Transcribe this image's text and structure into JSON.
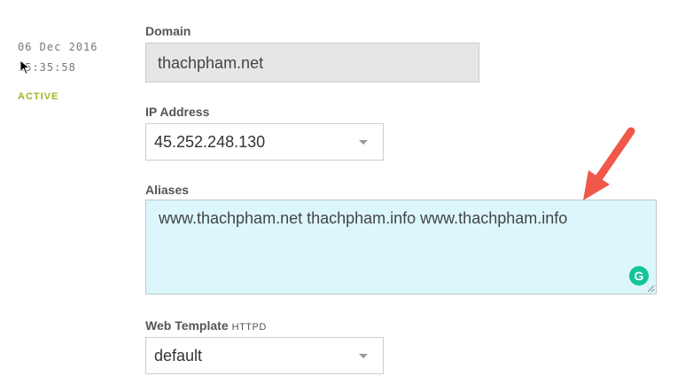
{
  "meta": {
    "date": "06 Dec 2016",
    "time": "15:35:58",
    "status": "ACTIVE"
  },
  "form": {
    "domain": {
      "label": "Domain",
      "value": "thachpham.net"
    },
    "ip_address": {
      "label": "IP Address",
      "value": "45.252.248.130"
    },
    "aliases": {
      "label": "Aliases",
      "value": "www.thachpham.net thachpham.info www.thachpham.info"
    },
    "web_template": {
      "label": "Web Template",
      "sublabel": "HTTPD",
      "value": "default"
    }
  },
  "icons": {
    "grammarly": {
      "name": "grammarly-icon",
      "glyph": "G",
      "color": "#15c39a"
    },
    "caret": "chevron-down-icon",
    "annotation_arrow_color": "#f0584a"
  },
  "colors": {
    "status_active": "#9ab728",
    "aliases_bg": "#dcf7fc",
    "readonly_bg": "#e6e6e6"
  }
}
